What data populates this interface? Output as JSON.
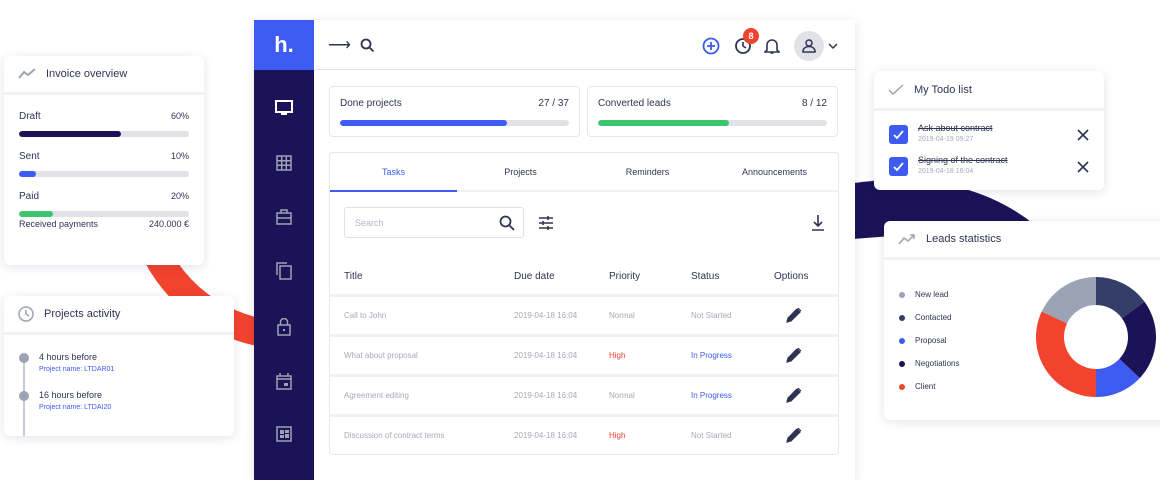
{
  "colors": {
    "navy": "#1b1257",
    "blue": "#3d5af1",
    "green": "#3cc46e",
    "red": "#f2432e",
    "grey": "#9ca3b4",
    "slate": "#343e66"
  },
  "invoice": {
    "title": "Invoice overview",
    "items": [
      {
        "label": "Draft",
        "value": "60%",
        "percent": 60
      },
      {
        "label": "Sent",
        "value": "10%",
        "percent": 10
      },
      {
        "label": "Paid",
        "value": "20%",
        "percent": 20
      }
    ],
    "received_label": "Received payments",
    "received_value": "240.000 €"
  },
  "activity": {
    "title": "Projects activity",
    "items": [
      {
        "time": "4 hours before",
        "project": "Project name: LTDAR01"
      },
      {
        "time": "16 hours before",
        "project": "Project name: LTDAI20"
      }
    ]
  },
  "app": {
    "logo": "h.",
    "badge": "8"
  },
  "stats": [
    {
      "label": "Done projects",
      "value": "27 / 37",
      "percent": 73
    },
    {
      "label": "Converted leads",
      "value": "8 / 12",
      "percent": 57
    }
  ],
  "tabs": [
    "Tasks",
    "Projects",
    "Reminders",
    "Announcements"
  ],
  "search": {
    "placeholder": "Search"
  },
  "table": {
    "headers": [
      "Title",
      "Due date",
      "Priority",
      "Status",
      "Options"
    ],
    "rows": [
      {
        "title": "Call to John",
        "due": "2019-04-18 16:04",
        "priority": "Normal",
        "status": "Not Started"
      },
      {
        "title": "What about proposal",
        "due": "2019-04-18 16:04",
        "priority": "High",
        "status": "In Progress"
      },
      {
        "title": "Agreement editing",
        "due": "2019-04-18 16:04",
        "priority": "Normal",
        "status": "In Progress"
      },
      {
        "title": "Discussion of contract terms",
        "due": "2019-04-18 16:04",
        "priority": "High",
        "status": "Not Started"
      }
    ]
  },
  "todo": {
    "title": "My Todo list",
    "items": [
      {
        "text": "Ask about contract",
        "date": "2019-04-19 09:27"
      },
      {
        "text": "Signing of the contract",
        "date": "2019-04-18 16:04"
      }
    ]
  },
  "chart_data": {
    "type": "pie",
    "title": "Leads statistics",
    "categories": [
      "New lead",
      "Contacted",
      "Proposal",
      "Negotiations",
      "Client"
    ],
    "values": [
      18,
      15,
      13,
      22,
      32
    ],
    "colors": [
      "#9ca3b4",
      "#343e66",
      "#3d5af1",
      "#1b1257",
      "#f2432e"
    ],
    "order_clockwise_from_top": [
      "Contacted",
      "Negotiations",
      "Proposal",
      "Client",
      "New lead"
    ]
  }
}
